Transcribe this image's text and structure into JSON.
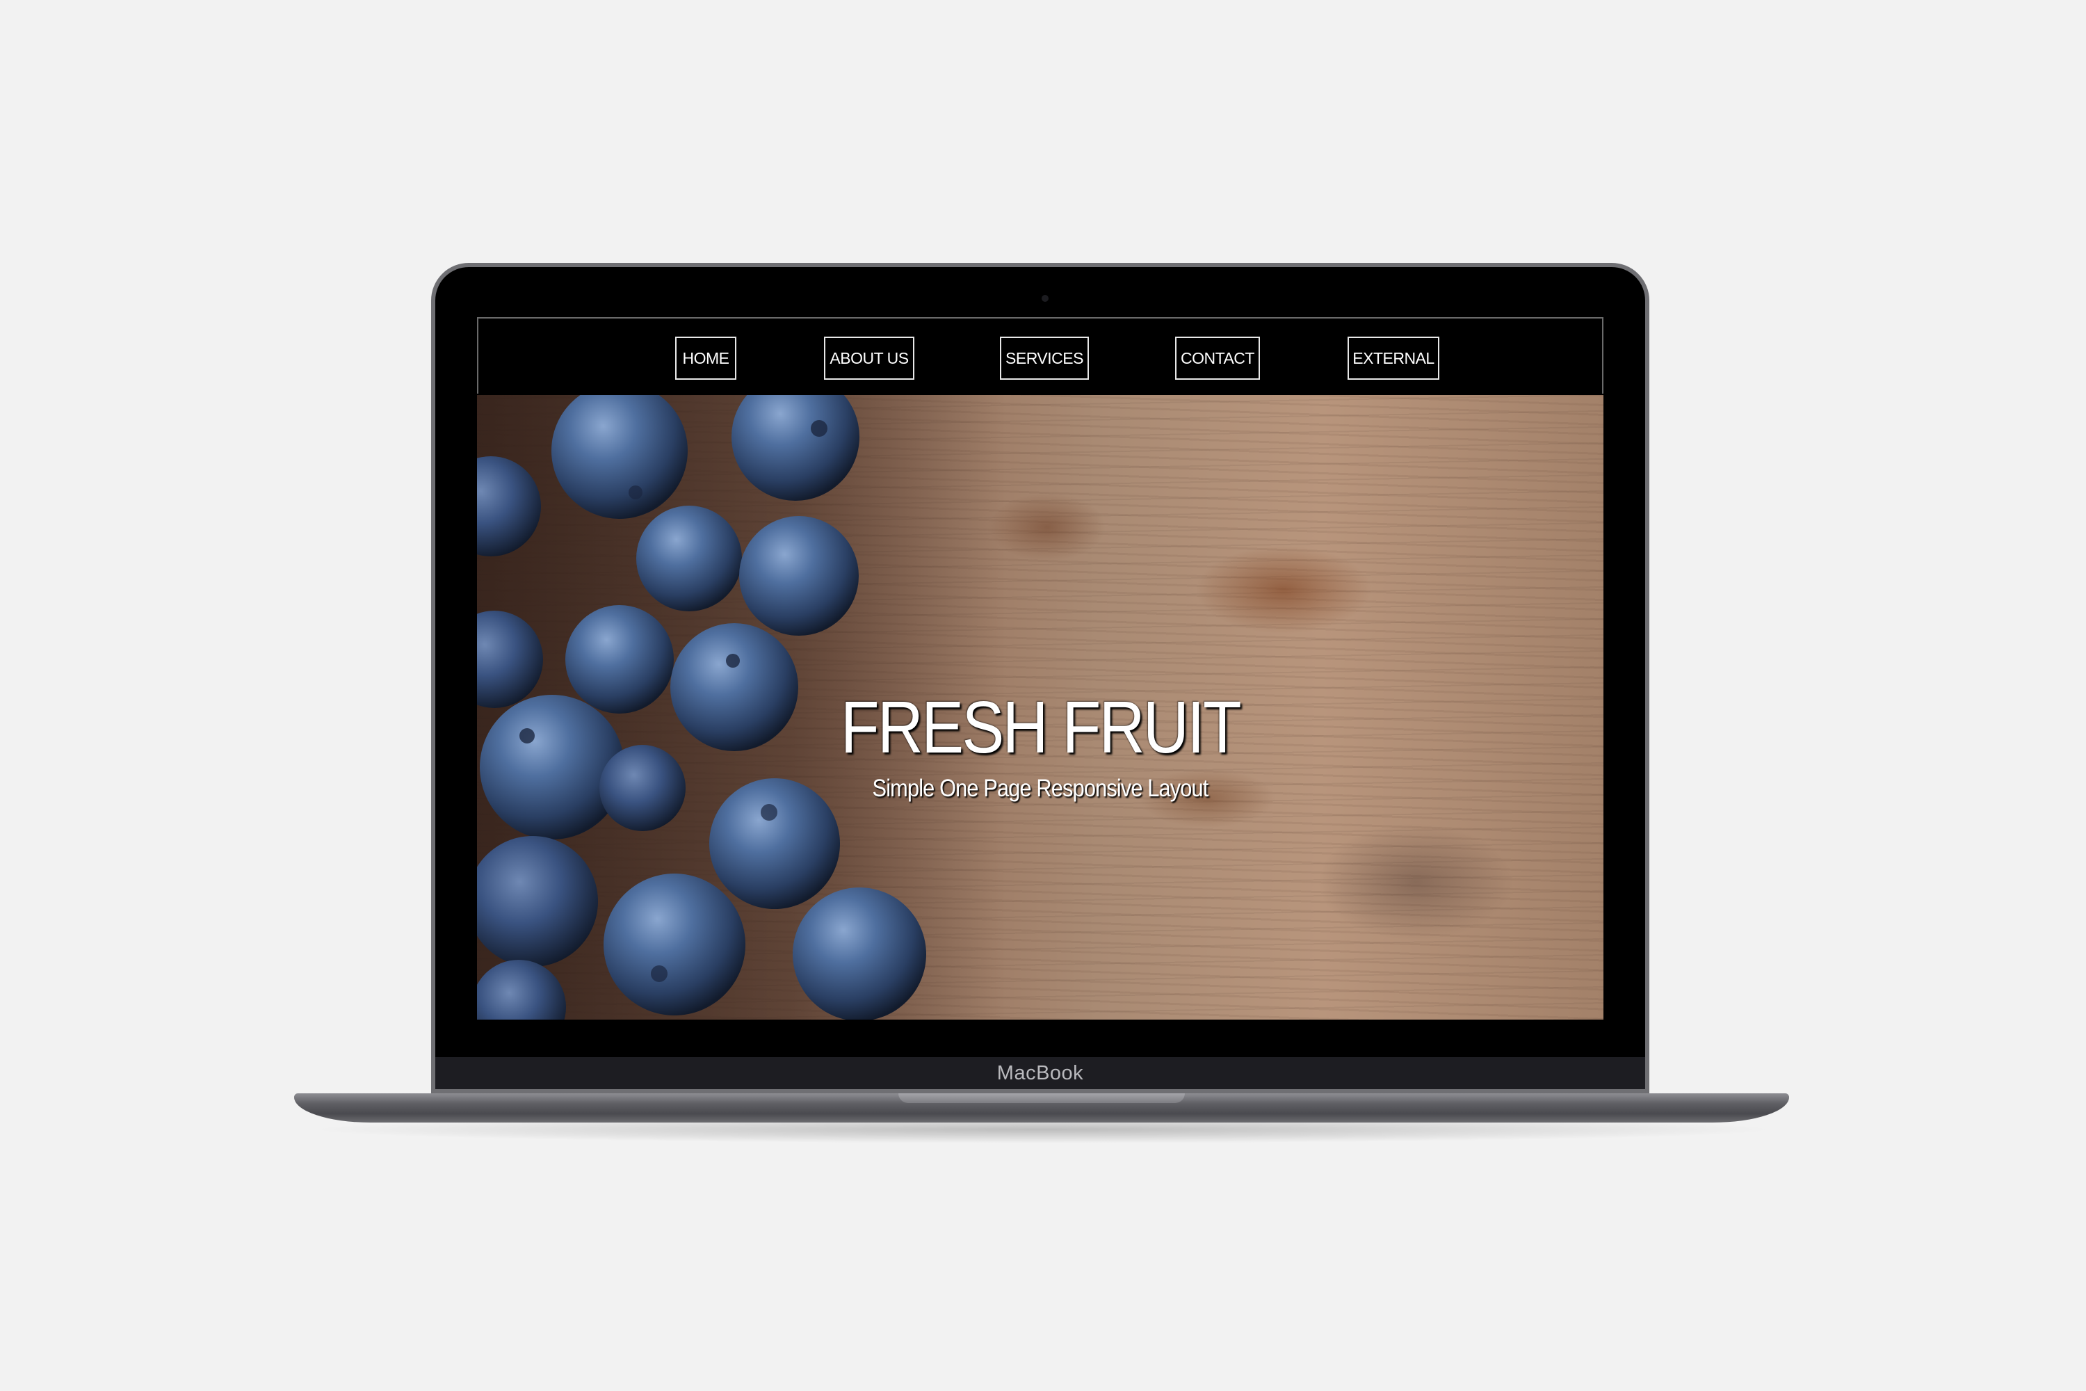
{
  "device": {
    "label": "MacBook"
  },
  "nav": {
    "items": [
      {
        "label": "HOME"
      },
      {
        "label": "ABOUT US"
      },
      {
        "label": "SERVICES"
      },
      {
        "label": "CONTACT"
      },
      {
        "label": "EXTERNAL"
      }
    ]
  },
  "hero": {
    "title": "FRESH FRUIT",
    "subtitle": "Simple One Page Responsive Layout"
  },
  "colors": {
    "page_background": "#f2f2f2",
    "screen_background": "#000000",
    "nav_text": "#ffffff",
    "nav_border": "#e8e8e8",
    "berry_blue": "#3e5f8f",
    "wood": "#a98a73"
  },
  "icons": {
    "camera": "webcam-dot"
  }
}
